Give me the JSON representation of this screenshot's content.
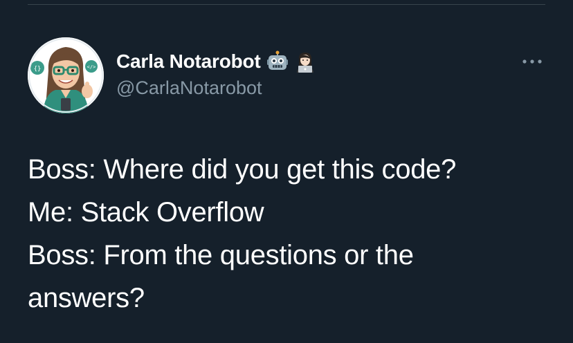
{
  "tweet": {
    "author": {
      "display_name": "Carla Notarobot",
      "handle": "@CarlaNotarobot",
      "avatar_icon": "avatar-cartoon-woman-with-glasses",
      "name_emojis": [
        "robot-face-emoji",
        "woman-technologist-emoji"
      ]
    },
    "text_lines": [
      "Boss: Where did you get this code?",
      "Me: Stack Overflow",
      "Boss: From the questions or the",
      "answers?"
    ],
    "more_options_icon": "more-horizontal-icon"
  },
  "colors": {
    "background": "#15202b",
    "primary_text": "#ffffff",
    "secondary_text": "#8899a6",
    "divider": "#38444d"
  }
}
